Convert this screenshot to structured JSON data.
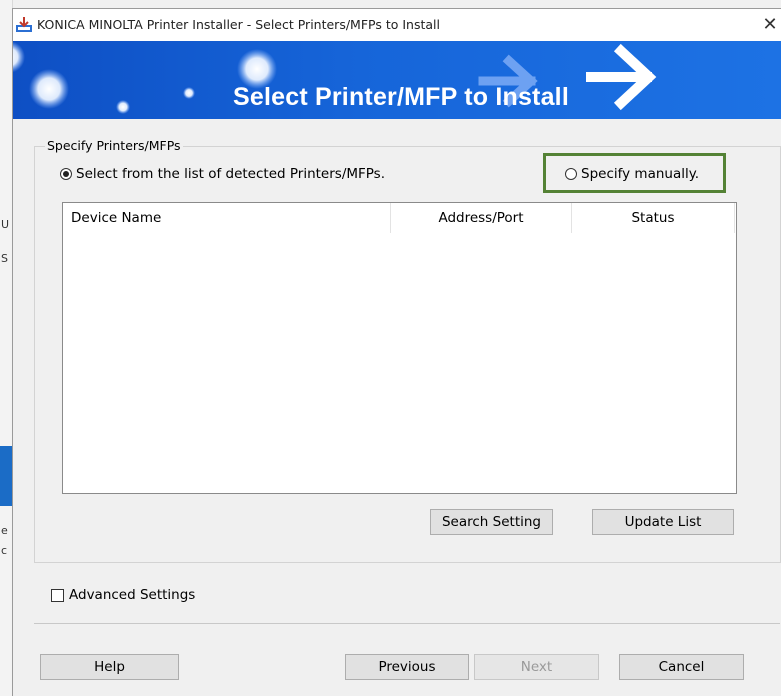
{
  "window": {
    "title": "KONICA MINOLTA Printer Installer - Select Printers/MFPs to Install",
    "close_glyph": "✕"
  },
  "banner": {
    "heading": "Select Printer/MFP to Install"
  },
  "specify": {
    "section_title": "Specify Printers/MFPs",
    "option_detected": "Select from the list of detected Printers/MFPs.",
    "option_manual": "Specify manually.",
    "selected": "detected"
  },
  "device_table": {
    "columns": [
      "Device Name",
      "Address/Port",
      "Status"
    ],
    "rows": []
  },
  "buttons": {
    "search_setting": "Search Setting",
    "update_list": "Update List",
    "help": "Help",
    "previous": "Previous",
    "next": "Next",
    "cancel": "Cancel"
  },
  "advanced": {
    "label": "Advanced Settings",
    "checked": false
  },
  "colors": {
    "banner_blue": "#1665d9",
    "highlight_green": "#548235"
  },
  "background_window": {
    "glyphs": [
      "U",
      "S",
      "e",
      "c"
    ]
  }
}
